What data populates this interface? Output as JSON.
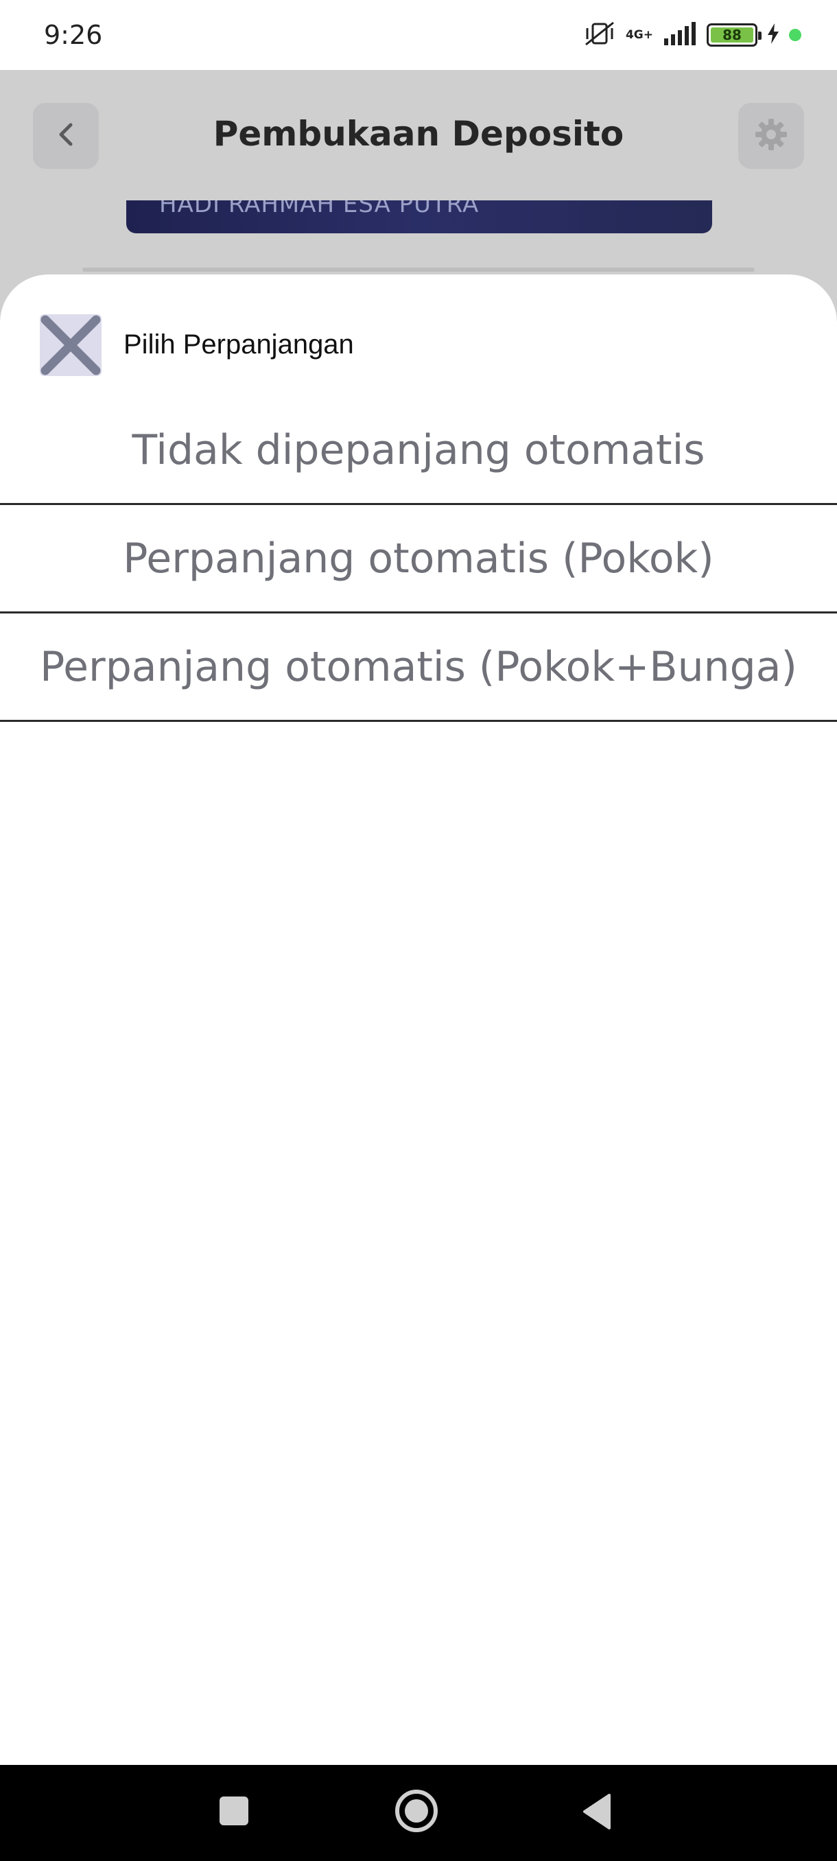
{
  "status_bar": {
    "time": "9:26",
    "network": "4G+",
    "battery": "88",
    "icons": [
      "mute-vibrate-icon",
      "signal-icon",
      "battery-icon",
      "charging-icon",
      "status-dot-icon"
    ]
  },
  "header": {
    "title": "Pembukaan Deposito",
    "back_icon": "chevron-left-icon",
    "settings_icon": "gear-icon"
  },
  "account": {
    "name": "HADI RAHMAH ESA PUTRA"
  },
  "sheet": {
    "title": "Pilih Perpanjangan",
    "close_icon": "close-icon",
    "options": [
      {
        "label": "Tidak dipepanjang otomatis"
      },
      {
        "label": "Perpanjang otomatis (Pokok)"
      },
      {
        "label": "Perpanjang otomatis (Pokok+Bunga)"
      }
    ]
  },
  "colors": {
    "overlay": "#cfcfcf",
    "card": "#23275a",
    "option_text": "#6f7078",
    "battery_fill": "#79c247"
  }
}
